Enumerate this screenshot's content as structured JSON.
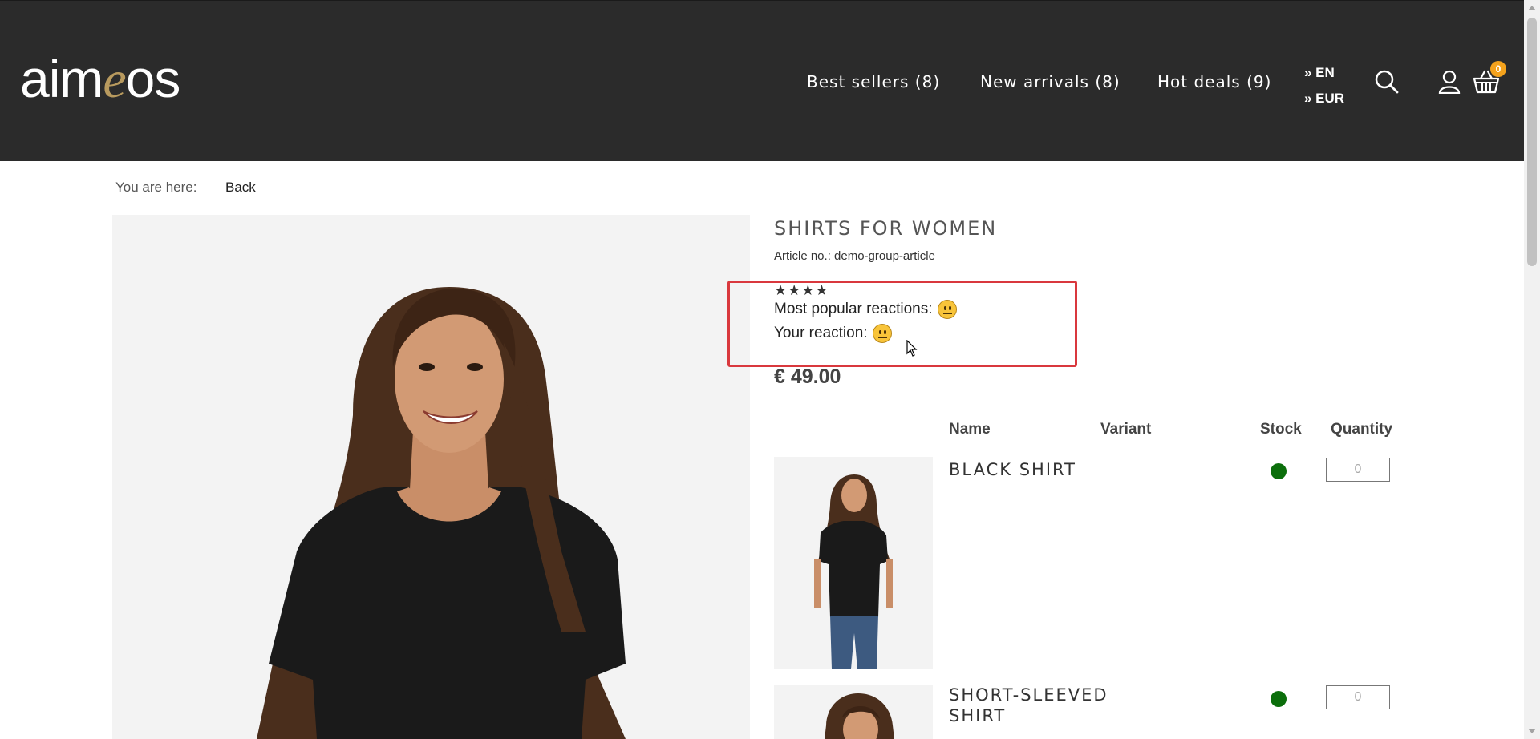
{
  "header": {
    "logo": {
      "pre": "aim",
      "mid": "e",
      "post": "os"
    },
    "nav": [
      {
        "label": "Best sellers (8)"
      },
      {
        "label": "New arrivals (8)"
      },
      {
        "label": "Hot deals (9)"
      }
    ],
    "language": "» EN",
    "currency": "» EUR",
    "cart_count": "0",
    "icons": [
      "search-icon",
      "user-icon",
      "basket-icon"
    ]
  },
  "breadcrumb": {
    "label": "You are here:",
    "back": "Back"
  },
  "product": {
    "title": "SHIRTS FOR WOMEN",
    "article": "Article no.: demo-group-article",
    "stars": "★★★★",
    "rating": 4,
    "popular_reactions_label": "Most popular reactions:",
    "your_reaction_label": "Your reaction:",
    "reaction_emoji": "neutral-face",
    "price": "€ 49.00"
  },
  "variants": {
    "headers": {
      "name": "Name",
      "variant": "Variant",
      "stock": "Stock",
      "quantity": "Quantity"
    },
    "rows": [
      {
        "name": "BLACK SHIRT",
        "quantity_placeholder": "0",
        "stock": "in-stock"
      },
      {
        "name": "SHORT-SLEEVED SHIRT",
        "quantity_placeholder": "0",
        "stock": "in-stock"
      }
    ]
  },
  "colors": {
    "header_bg": "#2b2b2b",
    "accent": "#b89a5e",
    "badge": "#f4a21c",
    "stock": "#0b6e0b",
    "highlight": "#d9383d"
  }
}
